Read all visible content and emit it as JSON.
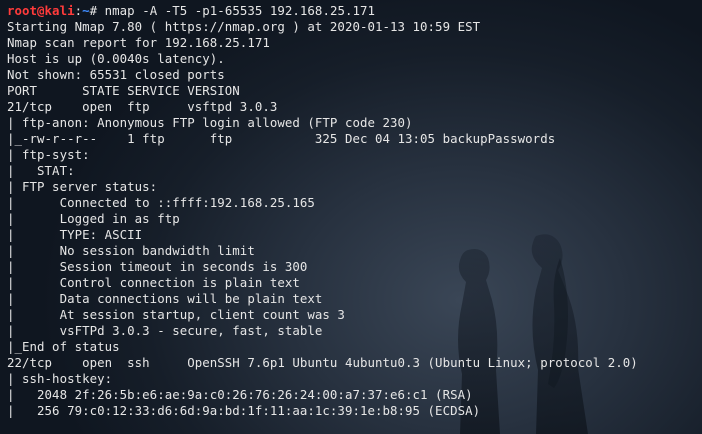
{
  "prompt": {
    "user_host": "root@kali",
    "separator": ":",
    "path": "~",
    "symbol": "# ",
    "command": "nmap -A -T5 -p1-65535 192.168.25.171"
  },
  "output_lines": [
    "Starting Nmap 7.80 ( https://nmap.org ) at 2020-01-13 10:59 EST",
    "Nmap scan report for 192.168.25.171",
    "Host is up (0.0040s latency).",
    "Not shown: 65531 closed ports",
    "PORT      STATE SERVICE VERSION",
    "21/tcp    open  ftp     vsftpd 3.0.3",
    "| ftp-anon: Anonymous FTP login allowed (FTP code 230)",
    "|_-rw-r--r--    1 ftp      ftp           325 Dec 04 13:05 backupPasswords",
    "| ftp-syst:",
    "|   STAT:",
    "| FTP server status:",
    "|      Connected to ::ffff:192.168.25.165",
    "|      Logged in as ftp",
    "|      TYPE: ASCII",
    "|      No session bandwidth limit",
    "|      Session timeout in seconds is 300",
    "|      Control connection is plain text",
    "|      Data connections will be plain text",
    "|      At session startup, client count was 3",
    "|      vsFTPd 3.0.3 - secure, fast, stable",
    "|_End of status",
    "22/tcp    open  ssh     OpenSSH 7.6p1 Ubuntu 4ubuntu0.3 (Ubuntu Linux; protocol 2.0)",
    "| ssh-hostkey:",
    "|   2048 2f:26:5b:e6:ae:9a:c0:26:76:26:24:00:a7:37:e6:c1 (RSA)",
    "|   256 79:c0:12:33:d6:6d:9a:bd:1f:11:aa:1c:39:1e:b8:95 (ECDSA)"
  ],
  "colors": {
    "text": "#e6e6e6",
    "prompt_user": "#ff3b3b",
    "prompt_path": "#3f8cff",
    "background": "#1b2430"
  }
}
